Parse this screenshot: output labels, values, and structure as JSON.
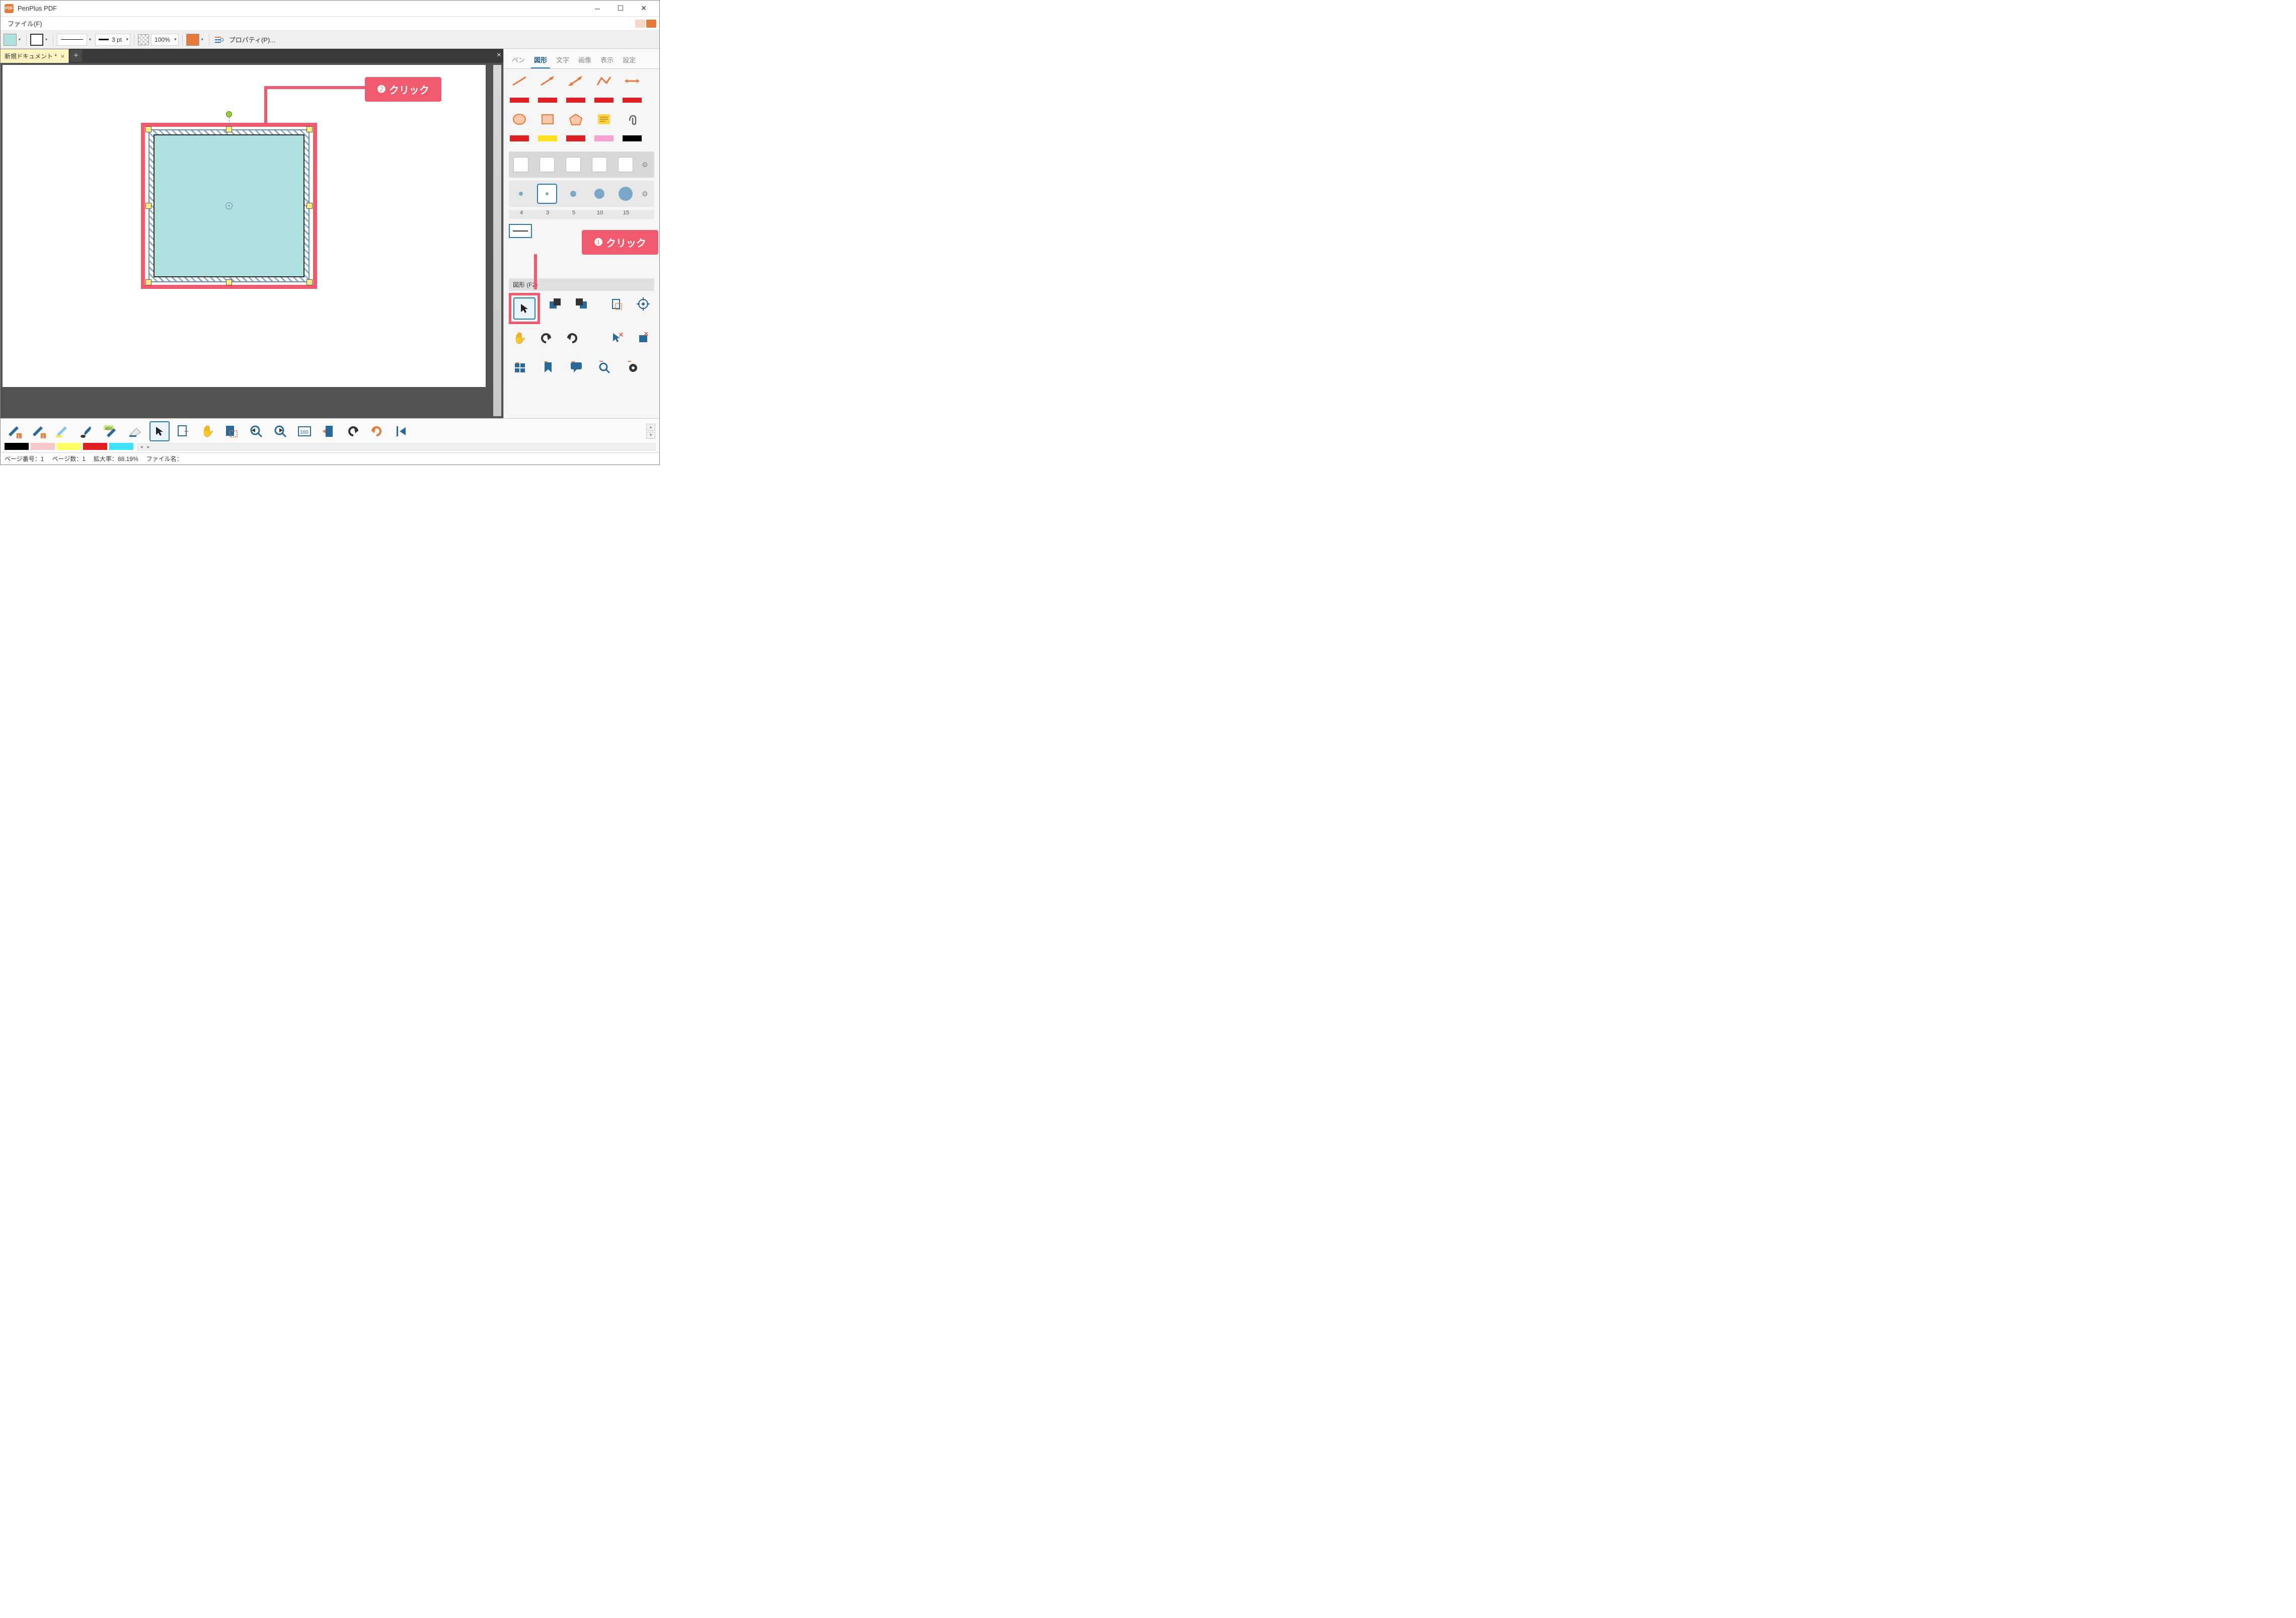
{
  "app": {
    "title": "PenPlus PDF",
    "icon_label": "PDF"
  },
  "menubar": {
    "file": "ファイル(F)"
  },
  "toolbar": {
    "fill_color": "#aee0e0",
    "stroke_color": "#ffffff",
    "line_weight": "3 pt",
    "opacity": "100%",
    "highlight_color": "#e67a3a",
    "properties_label": "プロパティ(P)..."
  },
  "doc": {
    "tab_title": "新規ドキュメント *"
  },
  "right_panel": {
    "tabs": [
      "ペン",
      "図形",
      "文字",
      "画像",
      "表示",
      "設定"
    ],
    "active_tab_index": 1,
    "pen_sizes": [
      "4",
      "3",
      "5",
      "10",
      "15"
    ],
    "tools_label": "図形 (F2)"
  },
  "callouts": {
    "c1": {
      "num": "❶",
      "text": "クリック"
    },
    "c2": {
      "num": "❷",
      "text": "クリック"
    }
  },
  "status": {
    "page_no_label": "ページ番号：",
    "page_no": "1",
    "page_count_label": "ページ数：",
    "page_count": "1",
    "zoom_label": "拡大率：",
    "zoom": "88.19%",
    "filename_label": "ファイル名："
  },
  "colors": {
    "accent": "#ef5a6f",
    "primary": "#2a7ab8"
  }
}
